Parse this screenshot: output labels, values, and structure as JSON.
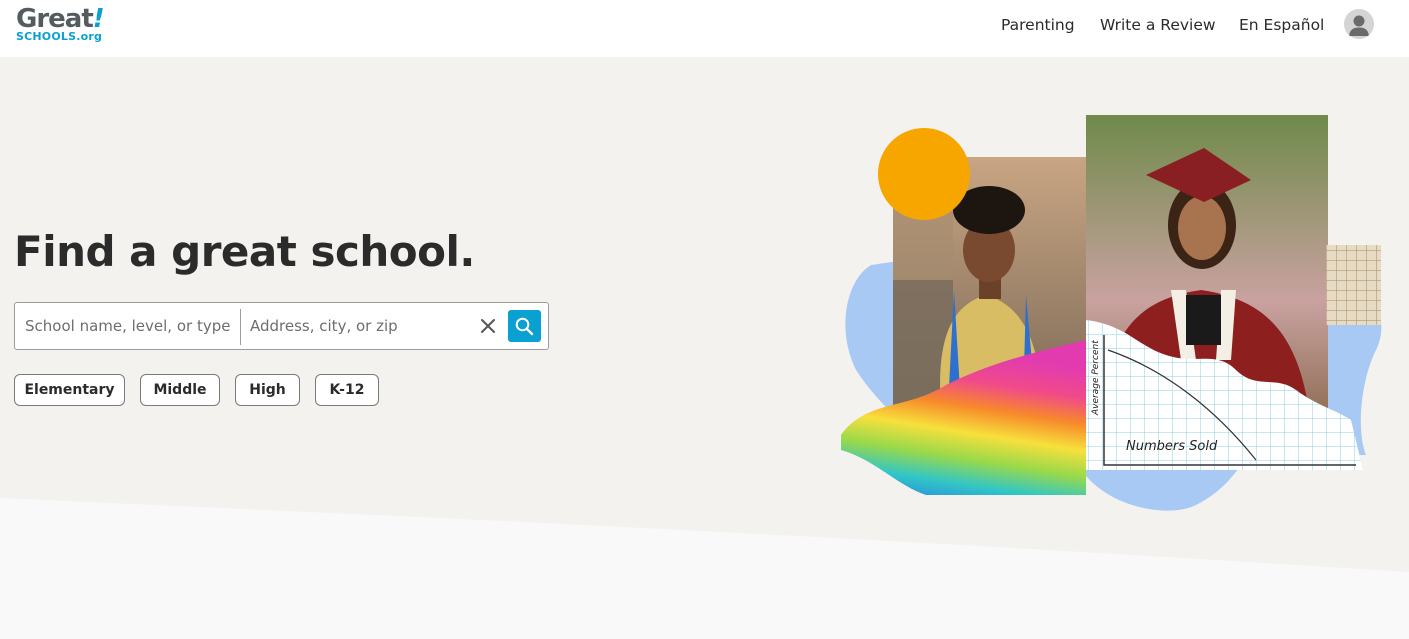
{
  "brand": {
    "logo_main": "Great",
    "logo_bang": "!",
    "logo_sub": "SCHOOLS.org"
  },
  "nav": {
    "items": [
      {
        "label": "Parenting"
      },
      {
        "label": "Write a Review"
      },
      {
        "label": "En Español"
      }
    ],
    "avatar_icon": "user-avatar-icon"
  },
  "hero": {
    "headline": "Find a great school.",
    "search": {
      "school_placeholder": "School name, level, or type",
      "address_placeholder": "Address, city, or zip",
      "clear_icon": "close-icon",
      "submit_icon": "search-icon"
    },
    "levels": [
      {
        "label": "Elementary"
      },
      {
        "label": "Middle"
      },
      {
        "label": "High"
      },
      {
        "label": "K-12"
      }
    ],
    "collage": {
      "graph_axis_label": "Average Percent",
      "graph_x_label": "Numbers Sold"
    }
  },
  "colors": {
    "brand_blue": "#0aa0d1",
    "logo_gray": "#555c60",
    "hero_bg": "#f3f2ef",
    "accent_orange": "#f7a600",
    "blob_blue": "#a9c9f5"
  }
}
